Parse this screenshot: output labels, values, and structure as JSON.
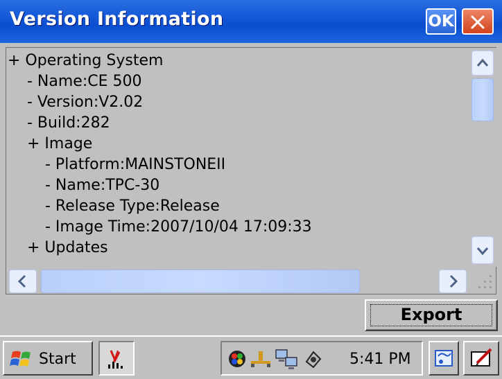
{
  "window": {
    "title": "Version Information",
    "ok_label": "OK"
  },
  "tree": [
    {
      "text": "+ Operating System",
      "indent": 0
    },
    {
      "text": "- Name:CE 500",
      "indent": 1
    },
    {
      "text": "- Version:V2.02",
      "indent": 1
    },
    {
      "text": "- Build:282",
      "indent": 1
    },
    {
      "text": "+ Image",
      "indent": 1
    },
    {
      "text": "- Platform:MAINSTONEII",
      "indent": 2
    },
    {
      "text": "- Name:TPC-30",
      "indent": 2
    },
    {
      "text": "- Release Type:Release",
      "indent": 2
    },
    {
      "text": "- Image Time:2007/10/04 17:09:33",
      "indent": 2
    },
    {
      "text": "+ Updates",
      "indent": 1
    }
  ],
  "actions": {
    "export_label": "Export"
  },
  "taskbar": {
    "start_label": "Start",
    "clock": "5:41 PM",
    "tray_icons": [
      "color-wheel-icon",
      "network-icon",
      "network-computers-icon",
      "device-icon"
    ],
    "running_app_icon": "app-graph-icon",
    "quick_icons": [
      "desktop-switch-icon",
      "input-panel-icon"
    ]
  },
  "colors": {
    "titlebar": "#0a4fd0",
    "background": "#c0c0c0",
    "close_button": "#d2431c",
    "scrollbar": "#c8daff"
  }
}
